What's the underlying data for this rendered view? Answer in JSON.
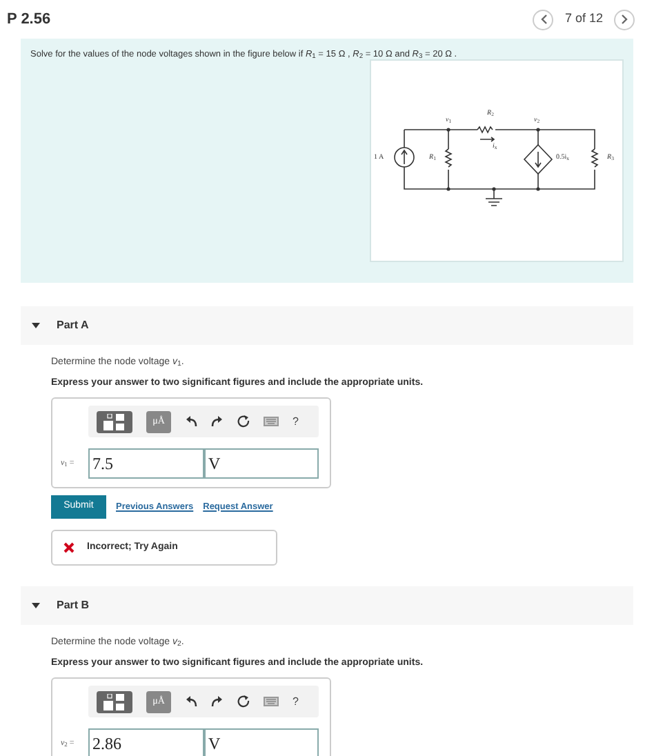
{
  "header": {
    "title": "P 2.56",
    "position": "7 of 12"
  },
  "problem": {
    "text": "Solve for the values of the node voltages shown in the figure below if *R*$_{1}$ = 15 Ω , *R*$_{2}$ = 10 Ω and *R*$_{3}$ = 20 Ω .",
    "figure_labels": [
      "*v*$_{1}$",
      "*R*$_{2}$",
      "*v*$_{2}$",
      "*i*$_{x}$",
      "1 A",
      "*R*$_{1}$",
      "0.5i$_{x}$",
      "*R*$_{3}$"
    ]
  },
  "parts": [
    {
      "title": "Part A",
      "expanded": true,
      "question": "Determine the node voltage *v*$_{1}$.",
      "instruction": "Express your answer to two significant figures and include the appropriate units.",
      "units_button": "μÅ",
      "help": "?",
      "variable": "*v*$_{1}$ =",
      "value": "7.5",
      "unit": "V",
      "submit": "Submit",
      "links": [
        "Previous Answers",
        "Request Answer"
      ],
      "feedback": "Incorrect; Try Again"
    },
    {
      "title": "Part B",
      "expanded": true,
      "question": "Determine the node voltage *v*$_{2}$.",
      "instruction": "Express your answer to two significant figures and include the appropriate units.",
      "units_button": "μÅ",
      "help": "?",
      "variable": "*v*$_{2}$ =",
      "value": "2.86",
      "unit": "V"
    }
  ]
}
